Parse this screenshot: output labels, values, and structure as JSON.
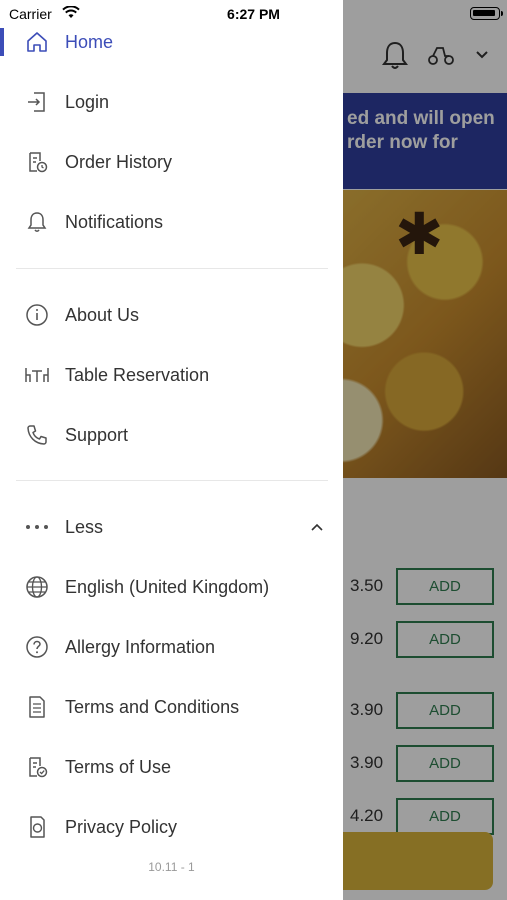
{
  "status_bar": {
    "carrier": "Carrier",
    "time": "6:27 PM"
  },
  "background": {
    "banner_lines": [
      "ed and will open",
      "rder now for"
    ],
    "prices": [
      "3.50",
      "9.20",
      "3.90",
      "3.90",
      "4.20"
    ],
    "add_label": "ADD"
  },
  "drawer": {
    "items": [
      {
        "label": "Home",
        "icon": "home-icon",
        "active": true
      },
      {
        "label": "Login",
        "icon": "login-icon"
      },
      {
        "label": "Order History",
        "icon": "order-history-icon"
      },
      {
        "label": "Notifications",
        "icon": "bell-icon"
      },
      {
        "label": "About Us",
        "icon": "info-icon"
      },
      {
        "label": "Table Reservation",
        "icon": "table-icon"
      },
      {
        "label": "Support",
        "icon": "phone-icon"
      },
      {
        "label": "Less",
        "icon": "more-dots-icon"
      },
      {
        "label": "English (United Kingdom)",
        "icon": "globe-icon"
      },
      {
        "label": "Allergy Information",
        "icon": "help-icon"
      },
      {
        "label": "Terms and Conditions",
        "icon": "document-icon"
      },
      {
        "label": "Terms of Use",
        "icon": "terms-icon"
      },
      {
        "label": "Privacy Policy",
        "icon": "privacy-icon"
      }
    ],
    "version": "10.11 - 1"
  },
  "colors": {
    "accent": "#3c4db8",
    "add_green": "#2f7d4f",
    "banner": "#2f3e9e"
  }
}
